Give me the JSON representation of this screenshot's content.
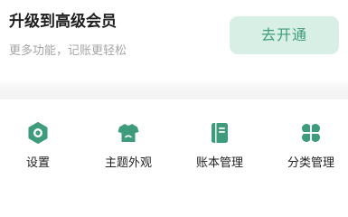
{
  "promo": {
    "title": "升级到高级会员",
    "subtitle": "更多功能，记账更轻松",
    "button_label": "去开通"
  },
  "tools": {
    "items": [
      {
        "label": "设置",
        "icon": "settings-icon"
      },
      {
        "label": "主题外观",
        "icon": "theme-shirt-icon"
      },
      {
        "label": "账本管理",
        "icon": "ledger-book-icon"
      },
      {
        "label": "分类管理",
        "icon": "category-clover-icon"
      }
    ]
  },
  "colors": {
    "accent": "#3e9b7b",
    "accent_light": "#d8efe6",
    "text_primary": "#1f1f1f",
    "text_secondary": "#a6a6a6"
  }
}
